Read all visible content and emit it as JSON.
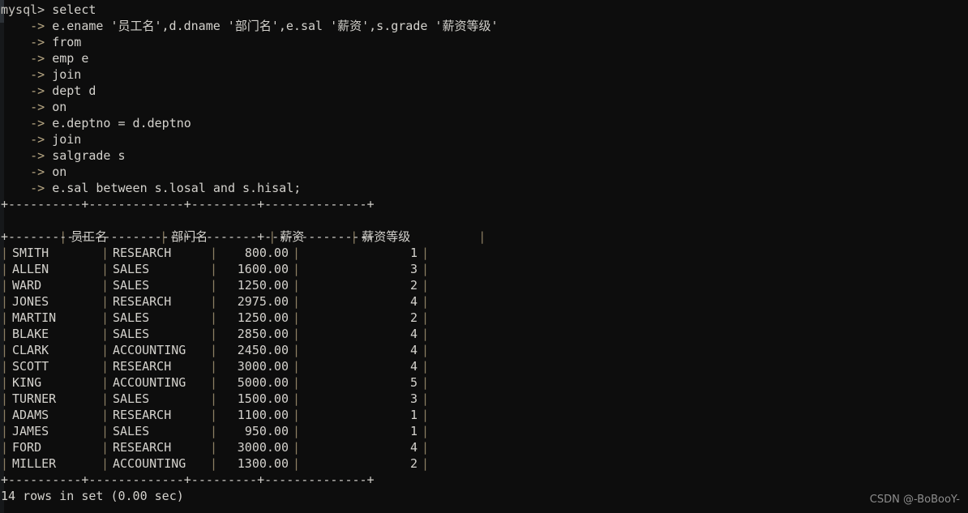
{
  "terminal": {
    "prompt": "mysql> ",
    "continuation": "    -> ",
    "first_command": "select",
    "query_lines": [
      "e.ename '员工名',d.dname '部门名',e.sal '薪资',s.grade '薪资等级'",
      "from",
      "emp e",
      "join",
      "dept d",
      "on",
      "e.deptno = d.deptno",
      "join",
      "salgrade s",
      "on",
      "e.sal between s.losal and s.hisal;"
    ],
    "status_line": "14 rows in set (0.00 sec)",
    "watermark": "CSDN @-BoBooY-",
    "colors": {
      "background": "#0d0d0d",
      "text": "#d4d2cd",
      "border": "#8c7f63",
      "watermark": "#8d8d8d"
    }
  },
  "result_table": {
    "rule": "+----------+-------------+---------+--------------+",
    "headers": [
      "员工名",
      "部门名",
      "薪资",
      "薪资等级"
    ],
    "rows": [
      {
        "ename": "SMITH",
        "dname": "RESEARCH",
        "sal": "800.00",
        "grade": "1"
      },
      {
        "ename": "ALLEN",
        "dname": "SALES",
        "sal": "1600.00",
        "grade": "3"
      },
      {
        "ename": "WARD",
        "dname": "SALES",
        "sal": "1250.00",
        "grade": "2"
      },
      {
        "ename": "JONES",
        "dname": "RESEARCH",
        "sal": "2975.00",
        "grade": "4"
      },
      {
        "ename": "MARTIN",
        "dname": "SALES",
        "sal": "1250.00",
        "grade": "2"
      },
      {
        "ename": "BLAKE",
        "dname": "SALES",
        "sal": "2850.00",
        "grade": "4"
      },
      {
        "ename": "CLARK",
        "dname": "ACCOUNTING",
        "sal": "2450.00",
        "grade": "4"
      },
      {
        "ename": "SCOTT",
        "dname": "RESEARCH",
        "sal": "3000.00",
        "grade": "4"
      },
      {
        "ename": "KING",
        "dname": "ACCOUNTING",
        "sal": "5000.00",
        "grade": "5"
      },
      {
        "ename": "TURNER",
        "dname": "SALES",
        "sal": "1500.00",
        "grade": "3"
      },
      {
        "ename": "ADAMS",
        "dname": "RESEARCH",
        "sal": "1100.00",
        "grade": "1"
      },
      {
        "ename": "JAMES",
        "dname": "SALES",
        "sal": "950.00",
        "grade": "1"
      },
      {
        "ename": "FORD",
        "dname": "RESEARCH",
        "sal": "3000.00",
        "grade": "4"
      },
      {
        "ename": "MILLER",
        "dname": "ACCOUNTING",
        "sal": "1300.00",
        "grade": "2"
      }
    ]
  }
}
